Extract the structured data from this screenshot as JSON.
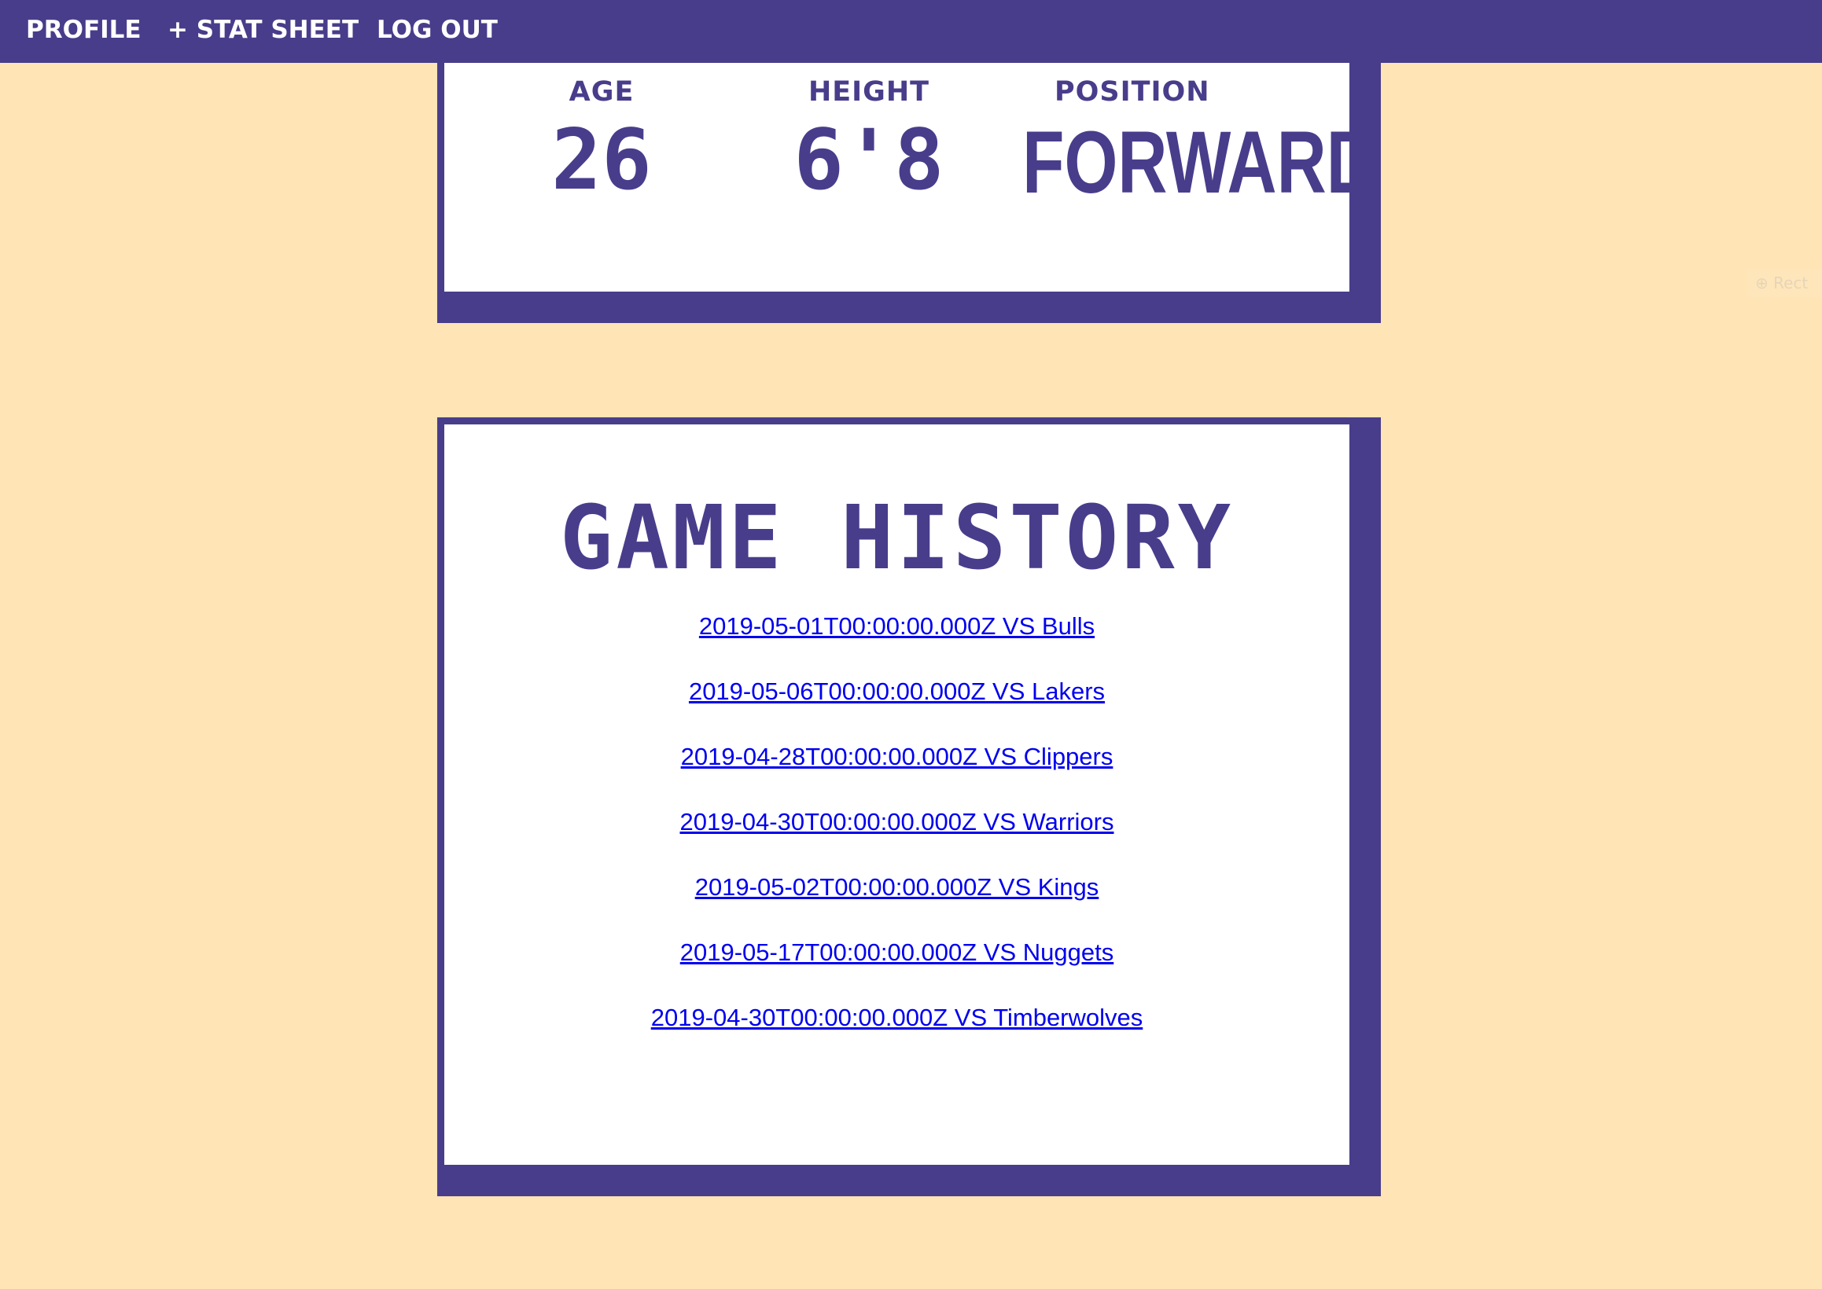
{
  "nav": {
    "profile_label": "PROFILE",
    "stat_sheet_label": "+ STAT SHEET",
    "logout_label": "LOG OUT"
  },
  "profile": {
    "age_label": "AGE",
    "age_value": "26",
    "height_label": "HEIGHT",
    "height_value": "6'8",
    "position_label": "POSITION",
    "position_value": "FORWARD"
  },
  "history": {
    "title": "GAME HISTORY",
    "games": [
      "2019-05-01T00:00:00.000Z VS Bulls",
      "2019-05-06T00:00:00.000Z VS Lakers",
      "2019-04-28T00:00:00.000Z VS Clippers",
      "2019-04-30T00:00:00.000Z VS Warriors",
      "2019-05-02T00:00:00.000Z VS Kings",
      "2019-05-17T00:00:00.000Z VS Nuggets",
      "2019-04-30T00:00:00.000Z VS Timberwolves"
    ]
  },
  "colors": {
    "primary": "#483D8B",
    "background": "#FFE4B5",
    "card": "#FFFFFF",
    "link": "#0000EE"
  }
}
